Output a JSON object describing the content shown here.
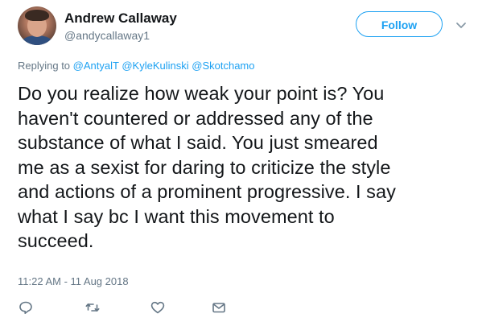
{
  "tweet": {
    "author_name": "Andrew Callaway",
    "author_handle": "@andycallaway1",
    "follow_label": "Follow",
    "replying_prefix": "Replying to",
    "mentions": [
      "@AntyalT",
      "@KyleKulinski",
      "@Skotchamo"
    ],
    "text_lines": [
      "Do you realize how weak your point is? You",
      "haven't countered or addressed any of the",
      "substance of what I said. You just smeared",
      "me as a sexist for daring to criticize the style",
      "and actions of a prominent progressive. I say",
      "what I say bc I want this movement to",
      "succeed."
    ],
    "timestamp": "11:22 AM - 11 Aug 2018"
  },
  "icons": {
    "reply": "reply-icon",
    "retweet": "retweet-icon",
    "like": "heart-icon",
    "message": "envelope-icon",
    "caret": "chevron-down-icon"
  },
  "colors": {
    "accent": "#1da1f2",
    "muted": "#657786",
    "text": "#14171a"
  }
}
